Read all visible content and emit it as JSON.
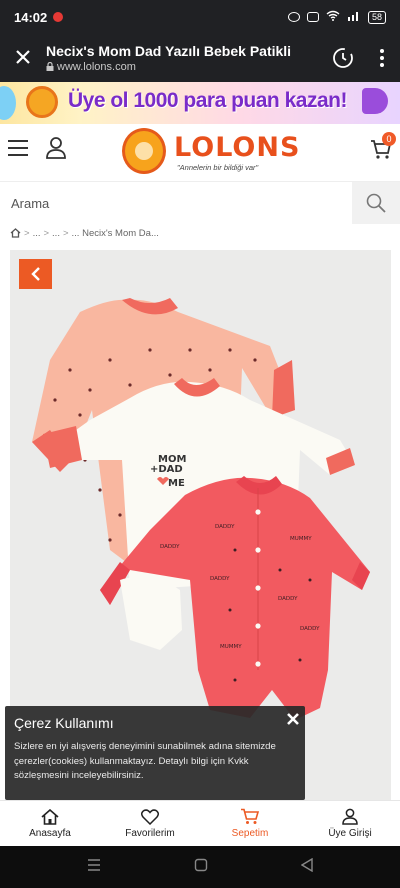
{
  "status_bar": {
    "time": "14:02",
    "battery": "58"
  },
  "browser": {
    "page_title": "Necix's Mom Dad Yazılı Bebek Patikli",
    "url": "www.lolons.com"
  },
  "promo_banner": {
    "text": "Üye ol 1000 para puan kazan!"
  },
  "header": {
    "logo_text": "LOLONS",
    "logo_tagline": "\"Annelerin bir bildiği var\"",
    "cart_count": "0"
  },
  "search": {
    "placeholder": "Arama"
  },
  "breadcrumb": {
    "items": [
      "...",
      "...",
      "... Necix's Mom Da..."
    ]
  },
  "product_image": {
    "print_text": "MOM + DAD = ME"
  },
  "cookie_notice": {
    "title": "Çerez Kullanımı",
    "body": "Sizlere en iyi alışveriş deneyimini sunabilmek adına sitemizde çerezler(cookies) kullanmaktayız. Detaylı bilgi için Kvkk sözleşmesini inceleyebilirsiniz."
  },
  "bottom_nav": {
    "items": [
      {
        "label": "Anasayfa",
        "icon": "home-icon"
      },
      {
        "label": "Favorilerim",
        "icon": "heart-icon"
      },
      {
        "label": "Sepetim",
        "icon": "cart-icon",
        "active": true
      },
      {
        "label": "Üye Girişi",
        "icon": "user-icon"
      }
    ]
  },
  "colors": {
    "accent": "#ec5a24",
    "brand_orange": "#e8501c",
    "dark_bar": "#202124"
  }
}
